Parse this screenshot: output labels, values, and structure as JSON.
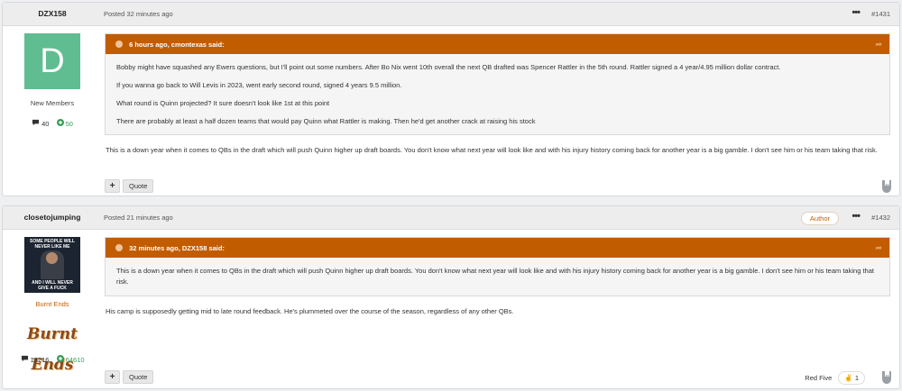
{
  "posts": [
    {
      "author": "DZX158",
      "posted": "Posted 32 minutes ago",
      "post_number": "#1431",
      "avatar_letter": "D",
      "rank": "New Members",
      "post_count": "40",
      "reputation": "50",
      "quote_header": "6 hours ago, cmontexas said:",
      "quote_paragraphs": [
        "Bobby might have squashed any Ewers questions, but I'll point out some numbers. After Bo Nix went 10th overall the next QB drafted was Spencer Rattler in the 5th round. Rattler signed a 4 year/4.95 million dollar contract.",
        "If you wanna go back to Will Levis in 2023, went early second round, signed 4 years 9.5 million.",
        "What round is Quinn projected? It sure doesn't look like 1st at this point",
        "There are probably at least a half dozen teams that would pay Quinn what Rattler is making. Then he'd get another crack at raising his stock"
      ],
      "body": "This is a down year when it comes to QBs in the draft which will push Quinn higher up draft boards. You don't know what next year will look like and with his injury history coming back for another year is a big gamble.  I don't see him or his team taking that risk.",
      "plus_label": "+",
      "quote_label": "Quote"
    },
    {
      "author": "closetojumping",
      "posted": "Posted 21 minutes ago",
      "post_number": "#1432",
      "author_badge": "Author",
      "avatar_meme_top": "SOME PEOPLE WILL NEVER LIKE ME",
      "avatar_meme_bottom": "AND I WILL NEVER GIVE A FUCK",
      "rank": "Burnt Ends",
      "rank_image_text": "Burnt Ends",
      "post_count": "13216",
      "reputation": "64610",
      "quote_header": "32 minutes ago, DZX158 said:",
      "quote_paragraphs": [
        "This is a down year when it comes to QBs in the draft which will push Quinn higher up draft boards. You don't know what next year will look like and with his injury history coming back for another year is a big gamble.  I don't see him or his team taking that risk."
      ],
      "body": "His camp is supposedly getting mid to late round feedback. He's plummeted over the course of the season, regardless of any other QBs.",
      "plus_label": "+",
      "quote_label": "Quote",
      "reaction_user": "Red Five",
      "reaction_count": "1"
    }
  ],
  "icons": {
    "more": "more-options-icon",
    "clock": "clock-icon",
    "share": "share-icon",
    "comment": "comment-icon",
    "reputation": "plus-circle-icon",
    "react": "rock-hand-icon"
  },
  "colors": {
    "quote_header": "#c25c00",
    "avatar_bg": "#5fbd91",
    "rank_orange": "#c25f00",
    "reputation_green": "#3a9d5a"
  }
}
